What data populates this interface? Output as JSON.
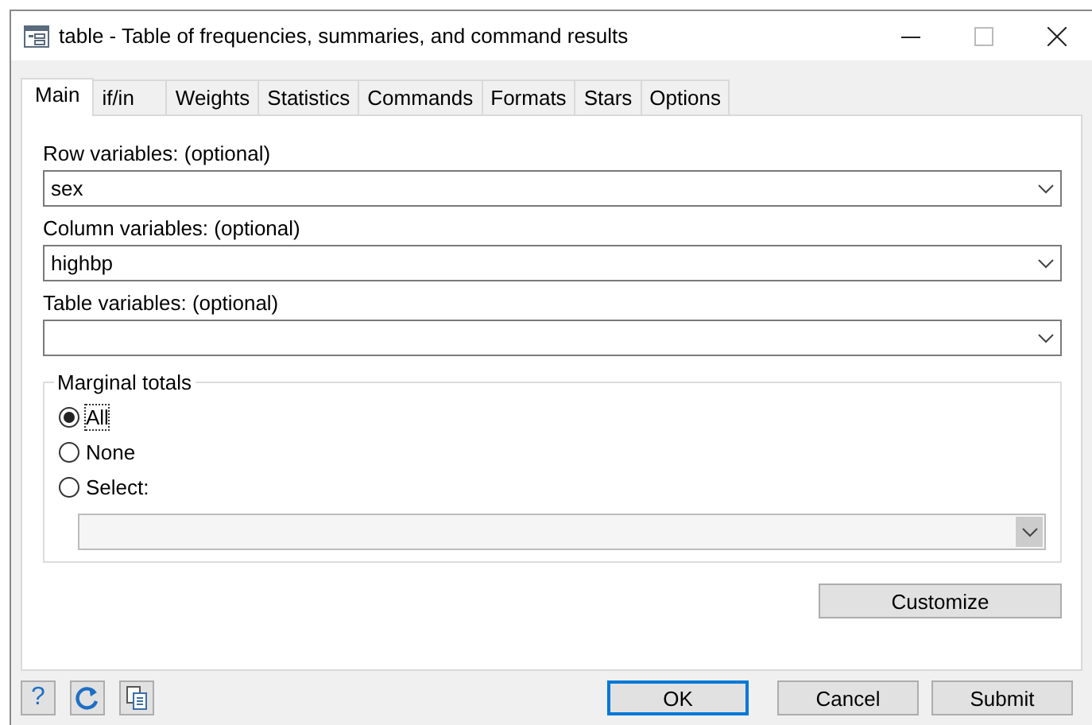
{
  "window": {
    "title": "table - Table of frequencies, summaries, and command results"
  },
  "tabs": [
    {
      "label": "Main",
      "selected": true
    },
    {
      "label": "if/in",
      "selected": false
    },
    {
      "label": "Weights",
      "selected": false
    },
    {
      "label": "Statistics",
      "selected": false
    },
    {
      "label": "Commands",
      "selected": false
    },
    {
      "label": "Formats",
      "selected": false
    },
    {
      "label": "Stars",
      "selected": false
    },
    {
      "label": "Options",
      "selected": false
    }
  ],
  "fields": [
    {
      "label": "Row variables: (optional)",
      "value": "sex"
    },
    {
      "label": "Column variables: (optional)",
      "value": "highbp"
    },
    {
      "label": "Table variables: (optional)"
    }
  ],
  "marginal_totals": {
    "title": "Marginal totals",
    "options": [
      {
        "label": "All",
        "selected": true
      },
      {
        "label": "None",
        "selected": false
      },
      {
        "label": "Select:",
        "selected": false
      }
    ],
    "select_field": {
      "disabled": true
    }
  },
  "customize_button": "Customize",
  "help_button": "?",
  "buttons": [
    {
      "label": "OK",
      "default": true
    },
    {
      "label": "Cancel",
      "default": false
    },
    {
      "label": "Submit",
      "default": false
    }
  ]
}
